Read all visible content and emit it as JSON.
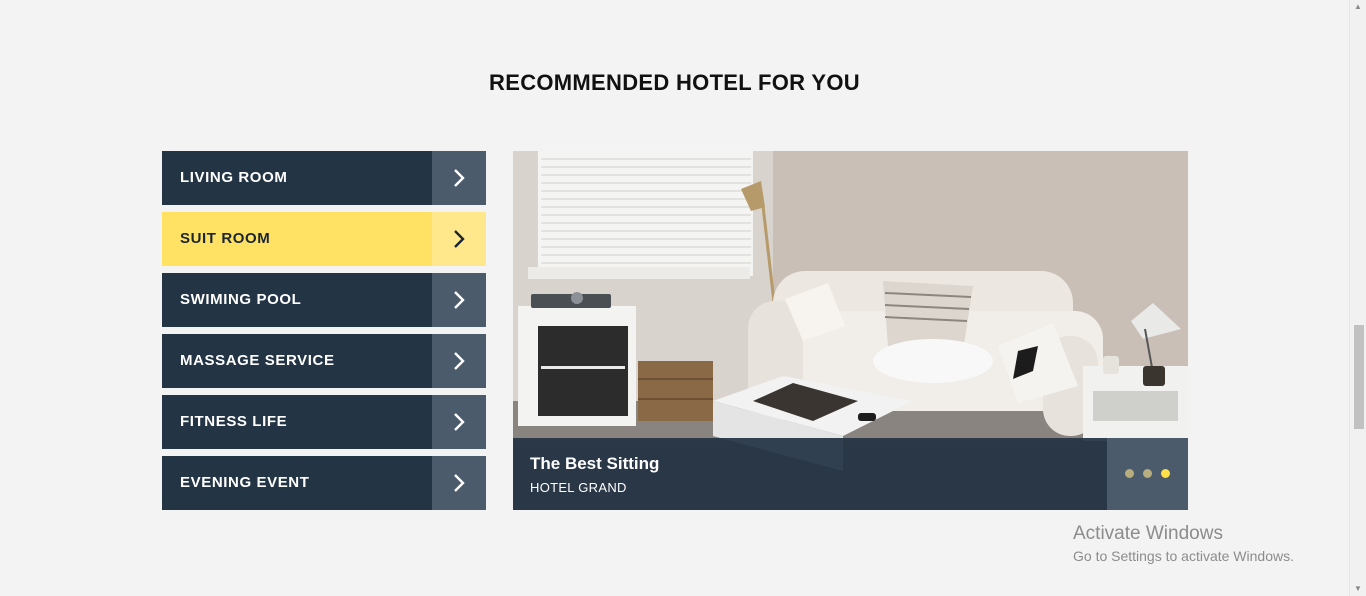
{
  "section": {
    "title": "RECOMMENDED HOTEL FOR YOU"
  },
  "menu": {
    "items": [
      {
        "label": "LIVING ROOM",
        "active": false
      },
      {
        "label": "SUIT ROOM",
        "active": true
      },
      {
        "label": "SWIMING POOL",
        "active": false
      },
      {
        "label": "MASSAGE SERVICE",
        "active": false
      },
      {
        "label": "FITNESS LIFE",
        "active": false
      },
      {
        "label": "EVENING EVENT",
        "active": false
      }
    ],
    "arrow_icon": "chevron-right-icon",
    "colors": {
      "item_bg": "#233445",
      "arrow_bg": "#4b5b6b",
      "active_bg": "#ffe164",
      "active_arrow_bg": "#ffe88c"
    }
  },
  "slider": {
    "caption_title": "The Best Sitting",
    "caption_subtitle": "HOTEL GRAND",
    "image_subject": "living-room-sofa-photo",
    "dots": [
      {
        "active": false
      },
      {
        "active": false
      },
      {
        "active": true
      }
    ],
    "colors": {
      "dot": "#b8ad7e",
      "dot_active": "#ffe14a"
    }
  },
  "watermark": {
    "title": "Activate Windows",
    "subtitle": "Go to Settings to activate Windows."
  }
}
